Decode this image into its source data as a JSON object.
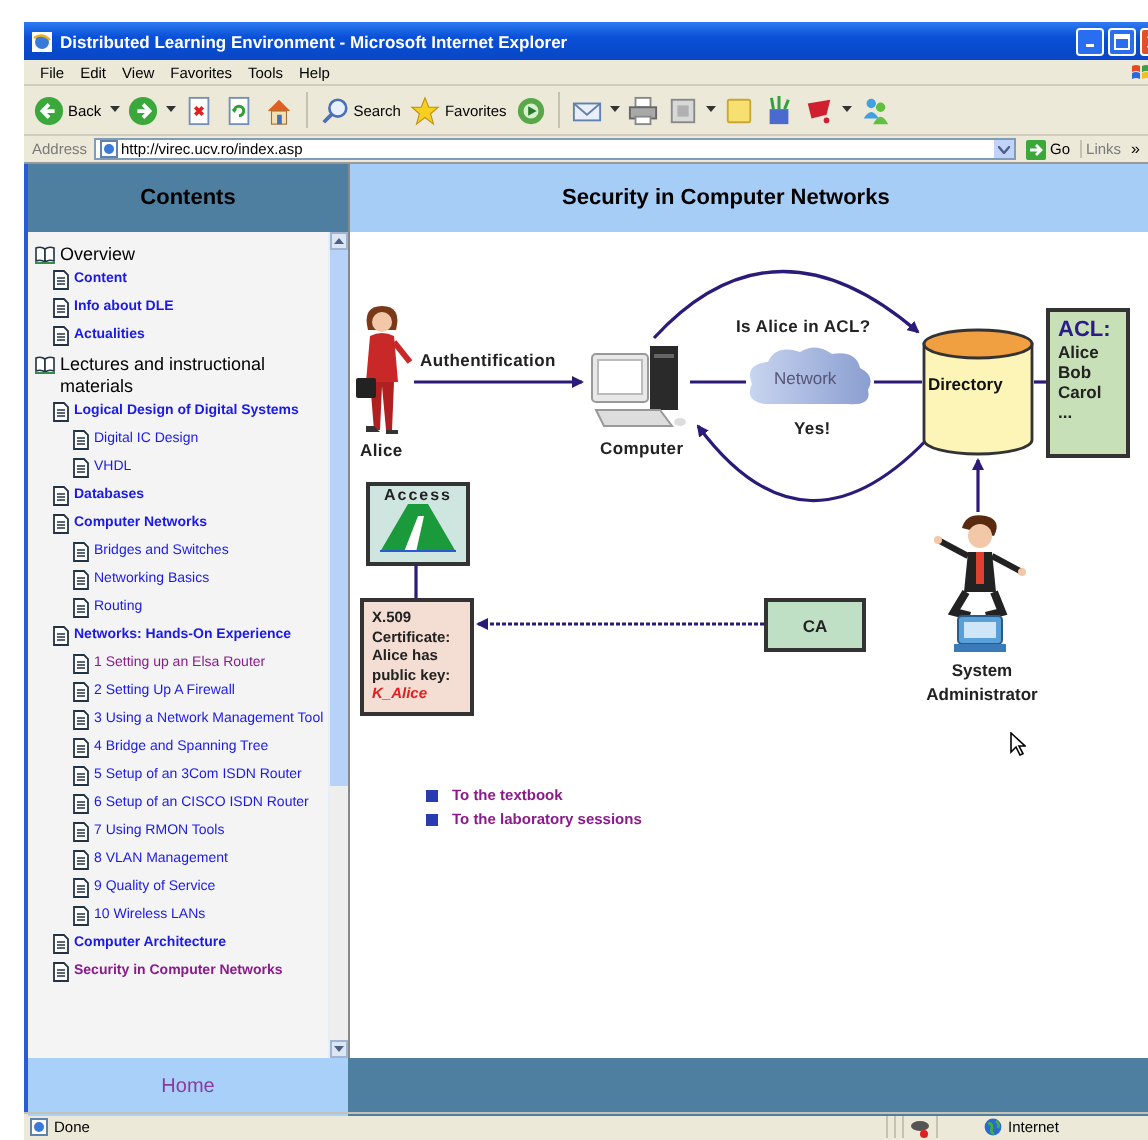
{
  "window": {
    "title": "Distributed Learning Environment - Microsoft Internet Explorer"
  },
  "menu": [
    "File",
    "Edit",
    "View",
    "Favorites",
    "Tools",
    "Help"
  ],
  "toolbar": [
    {
      "kind": "back",
      "label": "Back",
      "dropdown": true
    },
    {
      "kind": "forward",
      "dropdown": true
    },
    {
      "kind": "stop"
    },
    {
      "kind": "refresh"
    },
    {
      "kind": "home"
    },
    {
      "kind": "separator"
    },
    {
      "kind": "search",
      "label": "Search"
    },
    {
      "kind": "favorites",
      "label": "Favorites"
    },
    {
      "kind": "media"
    },
    {
      "kind": "separator"
    },
    {
      "kind": "mail",
      "dropdown": true
    },
    {
      "kind": "print"
    },
    {
      "kind": "edit",
      "dropdown": true
    },
    {
      "kind": "note"
    },
    {
      "kind": "paint"
    },
    {
      "kind": "yahoo",
      "dropdown": true
    },
    {
      "kind": "messenger"
    }
  ],
  "address": {
    "label": "Address",
    "url": "http://virec.ucv.ro/index.asp",
    "go": "Go",
    "links": "Links",
    "more": "»"
  },
  "contents": {
    "title": "Contents",
    "home": "Home",
    "tree": [
      {
        "kind": "book",
        "label": "Overview",
        "children": [
          {
            "kind": "page",
            "label": "Content",
            "visited": false
          },
          {
            "kind": "page",
            "label": "Info about DLE",
            "visited": false
          },
          {
            "kind": "page",
            "label": "Actualities",
            "visited": false
          }
        ]
      },
      {
        "kind": "book",
        "label": "Lectures and instructional materials",
        "children": [
          {
            "kind": "page",
            "label": "Logical Design of Digital Systems",
            "visited": false,
            "children": [
              {
                "kind": "page",
                "label": "Digital IC Design",
                "visited": false
              },
              {
                "kind": "page",
                "label": "VHDL",
                "visited": false
              }
            ]
          },
          {
            "kind": "page",
            "label": "Databases",
            "visited": false
          },
          {
            "kind": "page",
            "label": "Computer Networks",
            "visited": false,
            "children": [
              {
                "kind": "page",
                "label": "Bridges and Switches",
                "visited": false
              },
              {
                "kind": "page",
                "label": "Networking Basics",
                "visited": false
              },
              {
                "kind": "page",
                "label": "Routing",
                "visited": false
              }
            ]
          },
          {
            "kind": "page",
            "label": "Networks: Hands-On Experience",
            "visited": false,
            "children": [
              {
                "kind": "page",
                "label": "1 Setting up an Elsa Router",
                "visited": true
              },
              {
                "kind": "page",
                "label": "2 Setting Up A Firewall",
                "visited": false
              },
              {
                "kind": "page",
                "label": "3 Using a Network Management Tool",
                "visited": false
              },
              {
                "kind": "page",
                "label": "4 Bridge and Spanning Tree",
                "visited": false
              },
              {
                "kind": "page",
                "label": "5 Setup of an 3Com ISDN Router",
                "visited": false
              },
              {
                "kind": "page",
                "label": "6 Setup of an CISCO ISDN Router",
                "visited": false
              },
              {
                "kind": "page",
                "label": "7 Using RMON Tools",
                "visited": false
              },
              {
                "kind": "page",
                "label": "8 VLAN Management",
                "visited": false
              },
              {
                "kind": "page",
                "label": "9 Quality of Service",
                "visited": false
              },
              {
                "kind": "page",
                "label": "10 Wireless LANs",
                "visited": false
              }
            ]
          },
          {
            "kind": "page",
            "label": "Computer Architecture",
            "visited": false
          },
          {
            "kind": "page",
            "label": "Security in Computer Networks",
            "visited": true
          }
        ]
      }
    ]
  },
  "page": {
    "title": "Security in Computer Networks",
    "diagram": {
      "person": "Alice",
      "authentication": "Authentification",
      "computer": "Computer",
      "question": "Is Alice in ACL?",
      "network": "Network",
      "answer": "Yes!",
      "directory": "Directory",
      "acl_title": "ACL:",
      "acl_entries": [
        "Alice",
        "Bob",
        "Carol",
        "..."
      ],
      "access": "Access",
      "certificate": [
        "X.509",
        "Certificate:",
        "Alice has",
        "public key:"
      ],
      "certificate_key": "K_Alice",
      "ca": "CA",
      "admin": [
        "System",
        "Administrator"
      ]
    },
    "links": [
      {
        "label": "To the textbook",
        "visited": true
      },
      {
        "label": "To the laboratory sessions",
        "visited": true
      }
    ]
  },
  "status_bar": {
    "text": "Done",
    "zone": "Internet"
  }
}
